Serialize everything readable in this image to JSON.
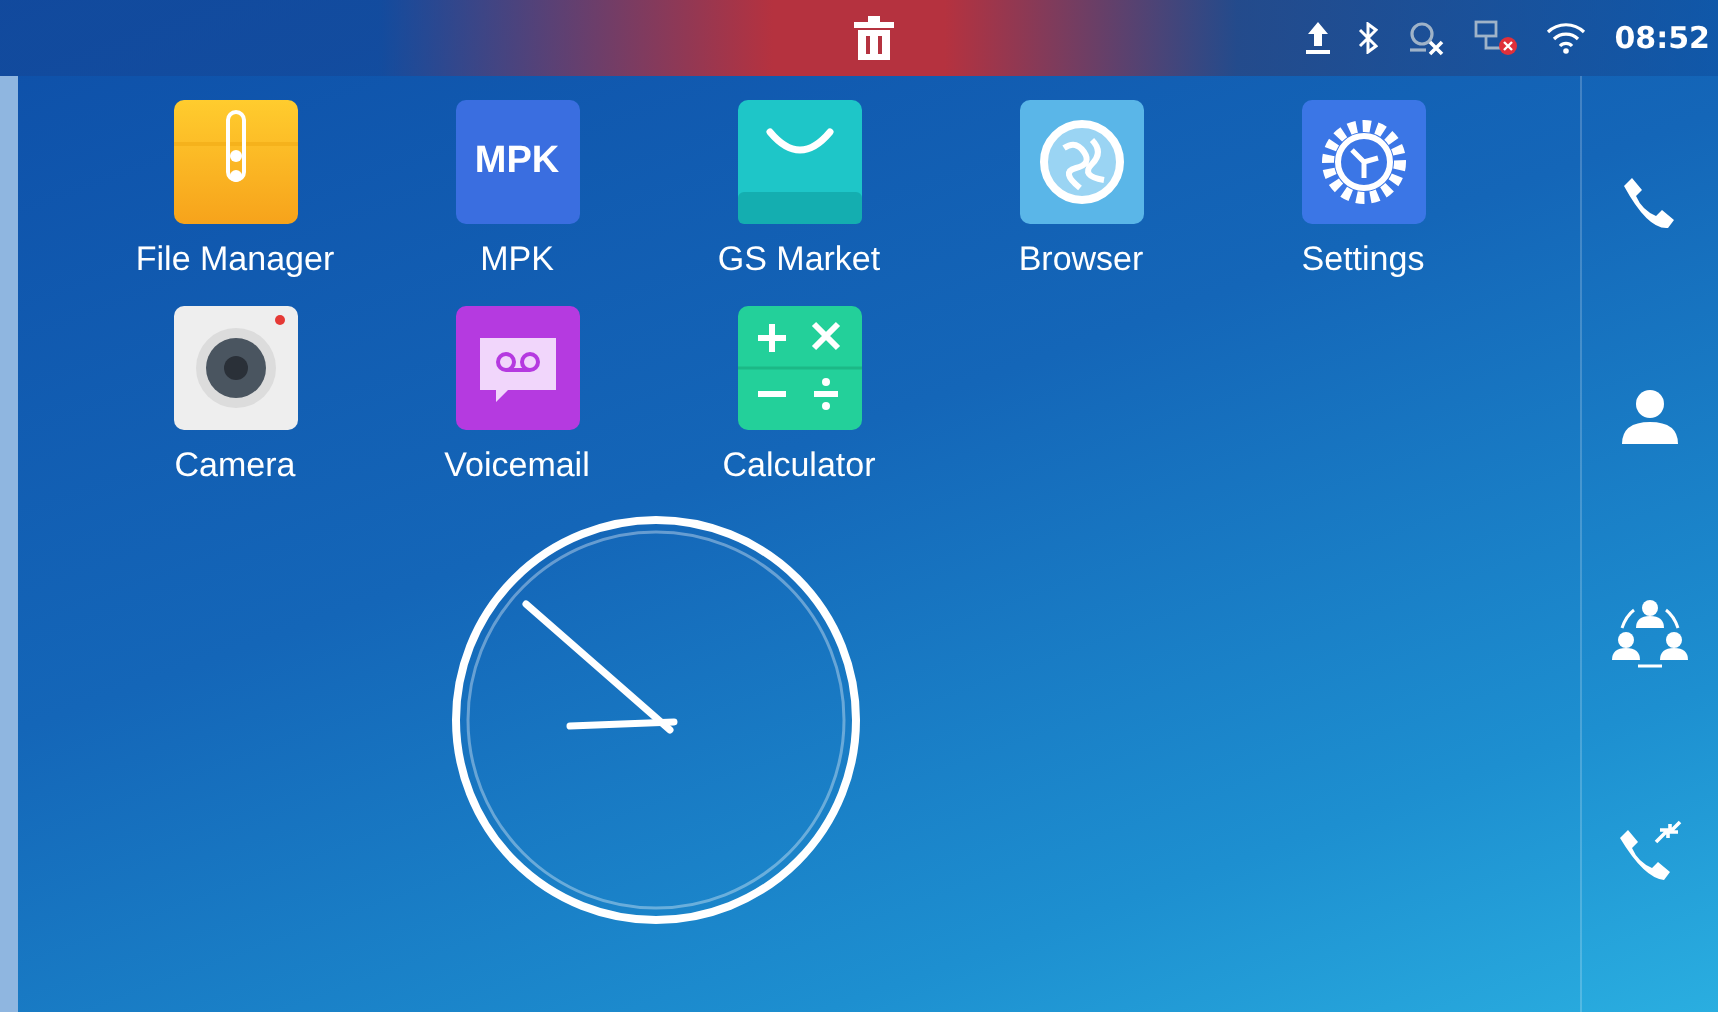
{
  "status_bar": {
    "icons": [
      {
        "kind": "upload"
      },
      {
        "kind": "bluetooth"
      },
      {
        "kind": "no-signal"
      },
      {
        "kind": "network-error"
      },
      {
        "kind": "wifi"
      }
    ],
    "time": "08:52"
  },
  "apps": [
    {
      "kind": "file-manager",
      "label": "File Manager"
    },
    {
      "kind": "mpk",
      "label": "MPK",
      "icon_text": "MPK"
    },
    {
      "kind": "market",
      "label": "GS Market"
    },
    {
      "kind": "browser",
      "label": "Browser"
    },
    {
      "kind": "settings",
      "label": "Settings"
    },
    {
      "kind": "camera",
      "label": "Camera"
    },
    {
      "kind": "voicemail",
      "label": "Voicemail"
    },
    {
      "kind": "calculator",
      "label": "Calculator"
    }
  ],
  "dock": [
    {
      "kind": "phone"
    },
    {
      "kind": "contact"
    },
    {
      "kind": "conference"
    },
    {
      "kind": "call-transfer"
    }
  ]
}
